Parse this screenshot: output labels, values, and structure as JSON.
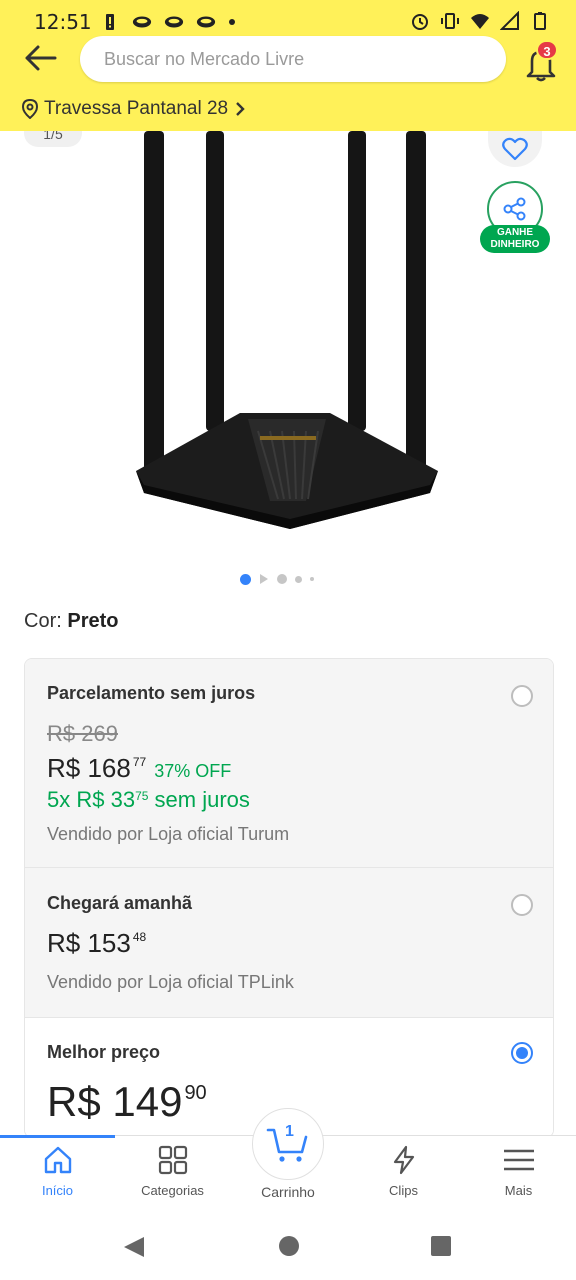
{
  "status": {
    "time": "12:51"
  },
  "header": {
    "search_placeholder": "Buscar no Mercado Livre",
    "notifications_count": "3",
    "address": "Travessa Pantanal 28"
  },
  "gallery": {
    "counter": "1/5",
    "share_label_line1": "GANHE",
    "share_label_line2": "DINHEIRO"
  },
  "product": {
    "color_label": "Cor:",
    "color_value": "Preto"
  },
  "offers": [
    {
      "title": "Parcelamento sem juros",
      "old_price": "R$ 269",
      "price": "R$ 168",
      "price_cents": "77",
      "discount": "37% OFF",
      "installments": "5x R$ 33",
      "installments_cents": "75",
      "installments_suffix": "sem juros",
      "seller": "Vendido por Loja oficial Turum"
    },
    {
      "title": "Chegará amanhã",
      "price": "R$ 153",
      "price_cents": "48",
      "seller": "Vendido por Loja oficial TPLink"
    },
    {
      "title": "Melhor preço",
      "price": "R$ 149",
      "price_cents": "90"
    }
  ],
  "bottom_nav": {
    "inicio": "Início",
    "categorias": "Categorias",
    "carrinho": "Carrinho",
    "cart_count": "1",
    "clips": "Clips",
    "mais": "Mais"
  },
  "colors": {
    "brand_yellow": "#fff159",
    "accent_blue": "#3483fa",
    "green": "#00a650"
  }
}
